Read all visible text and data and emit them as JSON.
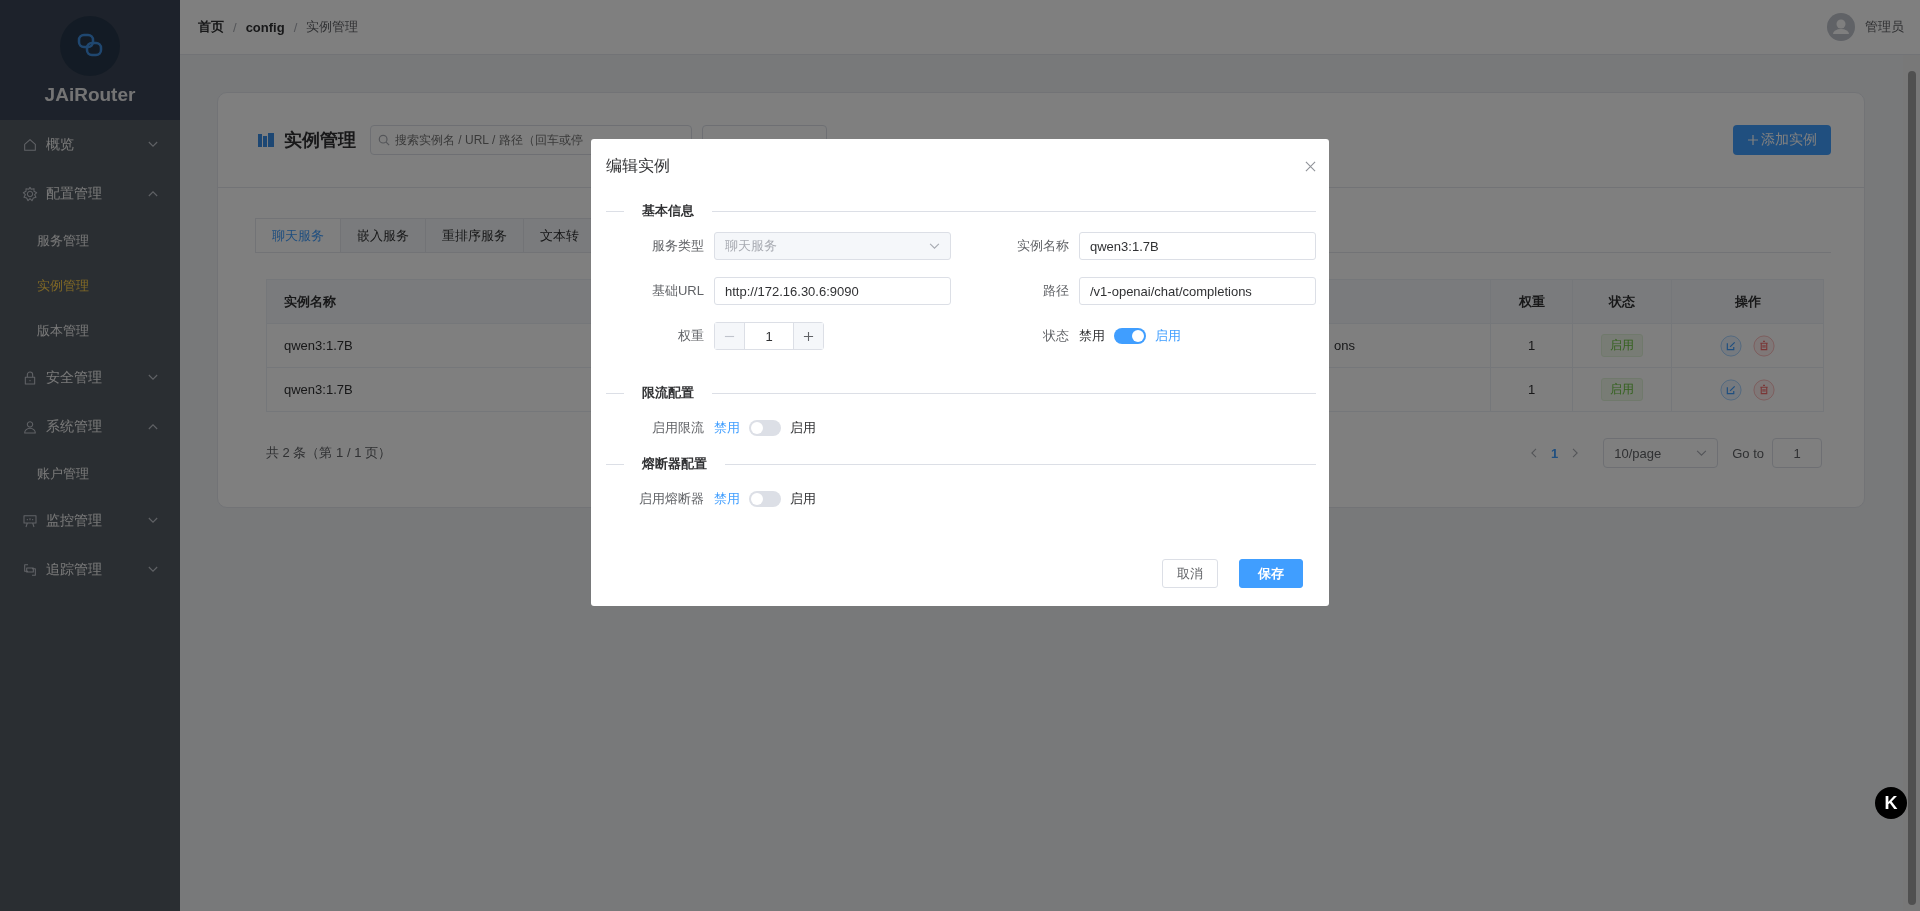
{
  "sidebar": {
    "brand": "JAiRouter",
    "menu": [
      {
        "label": "概览",
        "expanded": false
      },
      {
        "label": "配置管理",
        "expanded": true,
        "children": [
          {
            "label": "服务管理",
            "selected": false
          },
          {
            "label": "实例管理",
            "selected": true
          },
          {
            "label": "版本管理",
            "selected": false
          }
        ]
      },
      {
        "label": "安全管理",
        "expanded": false
      },
      {
        "label": "系统管理",
        "expanded": true,
        "children": [
          {
            "label": "账户管理",
            "selected": false
          }
        ]
      },
      {
        "label": "监控管理",
        "expanded": false
      },
      {
        "label": "追踪管理",
        "expanded": false
      }
    ]
  },
  "header": {
    "breadcrumb": [
      {
        "label": "首页"
      },
      {
        "separator": "/",
        "label": "config"
      },
      {
        "separator": "/",
        "label": "实例管理"
      }
    ],
    "user": "管理员"
  },
  "card": {
    "title": "实例管理",
    "search": {
      "placeholder": "搜索实例名 / URL / 路径（回车或停"
    },
    "add_button": "添加实例",
    "tabs": [
      {
        "label": "聊天服务",
        "selected": true
      },
      {
        "label": "嵌入服务",
        "selected": false
      },
      {
        "label": "重排序服务",
        "selected": false
      },
      {
        "label": "文本转",
        "selected": false
      }
    ],
    "table": {
      "columns": [
        "实例名称",
        "权重",
        "状态",
        "操作"
      ],
      "rows": [
        {
          "name": "qwen3:1.7B",
          "column_2": "ons",
          "weight": "1",
          "status": "启用"
        },
        {
          "name": "qwen3:1.7B",
          "weight": "1",
          "status": "启用"
        }
      ]
    },
    "pagination": {
      "summary": "共 2 条（第 1 / 1 页）",
      "pages": [
        {
          "label": "1",
          "selected": true
        }
      ],
      "page_size": "10/page",
      "goto_label": "Go to",
      "goto_value": "1"
    }
  },
  "dialog": {
    "title": "编辑实例",
    "sections": [
      {
        "title": "基本信息",
        "fields": [
          {
            "kind": "select",
            "label": "服务类型",
            "value": "聊天服务",
            "disabled": true
          },
          {
            "kind": "input",
            "label": "实例名称",
            "value": "qwen3:1.7B",
            "disabled": false
          },
          {
            "kind": "input",
            "label": "基础URL",
            "value": "http://172.16.30.6:9090",
            "disabled": false
          },
          {
            "kind": "input",
            "label": "路径",
            "value": "/v1-openai/chat/completions",
            "disabled": false
          },
          {
            "kind": "number",
            "label": "权重",
            "value": "1",
            "disabled": false
          },
          {
            "kind": "switch",
            "label": "状态",
            "off_label": "禁用",
            "on_label": "启用",
            "on": true,
            "disabled": false
          }
        ]
      },
      {
        "title": "限流配置",
        "fields": [
          {
            "kind": "switch",
            "label": "启用限流",
            "off_label": "禁用",
            "on_label": "启用",
            "on": false,
            "disabled": false
          }
        ]
      },
      {
        "title": "熔断器配置",
        "fields": [
          {
            "kind": "switch",
            "label": "启用熔断器",
            "off_label": "禁用",
            "on_label": "启用",
            "on": false,
            "disabled": false
          }
        ]
      }
    ],
    "buttons": [
      {
        "kind": "default",
        "label": "取消"
      },
      {
        "kind": "primary",
        "label": "保存"
      }
    ]
  },
  "floating_button": {
    "label": "K"
  }
}
